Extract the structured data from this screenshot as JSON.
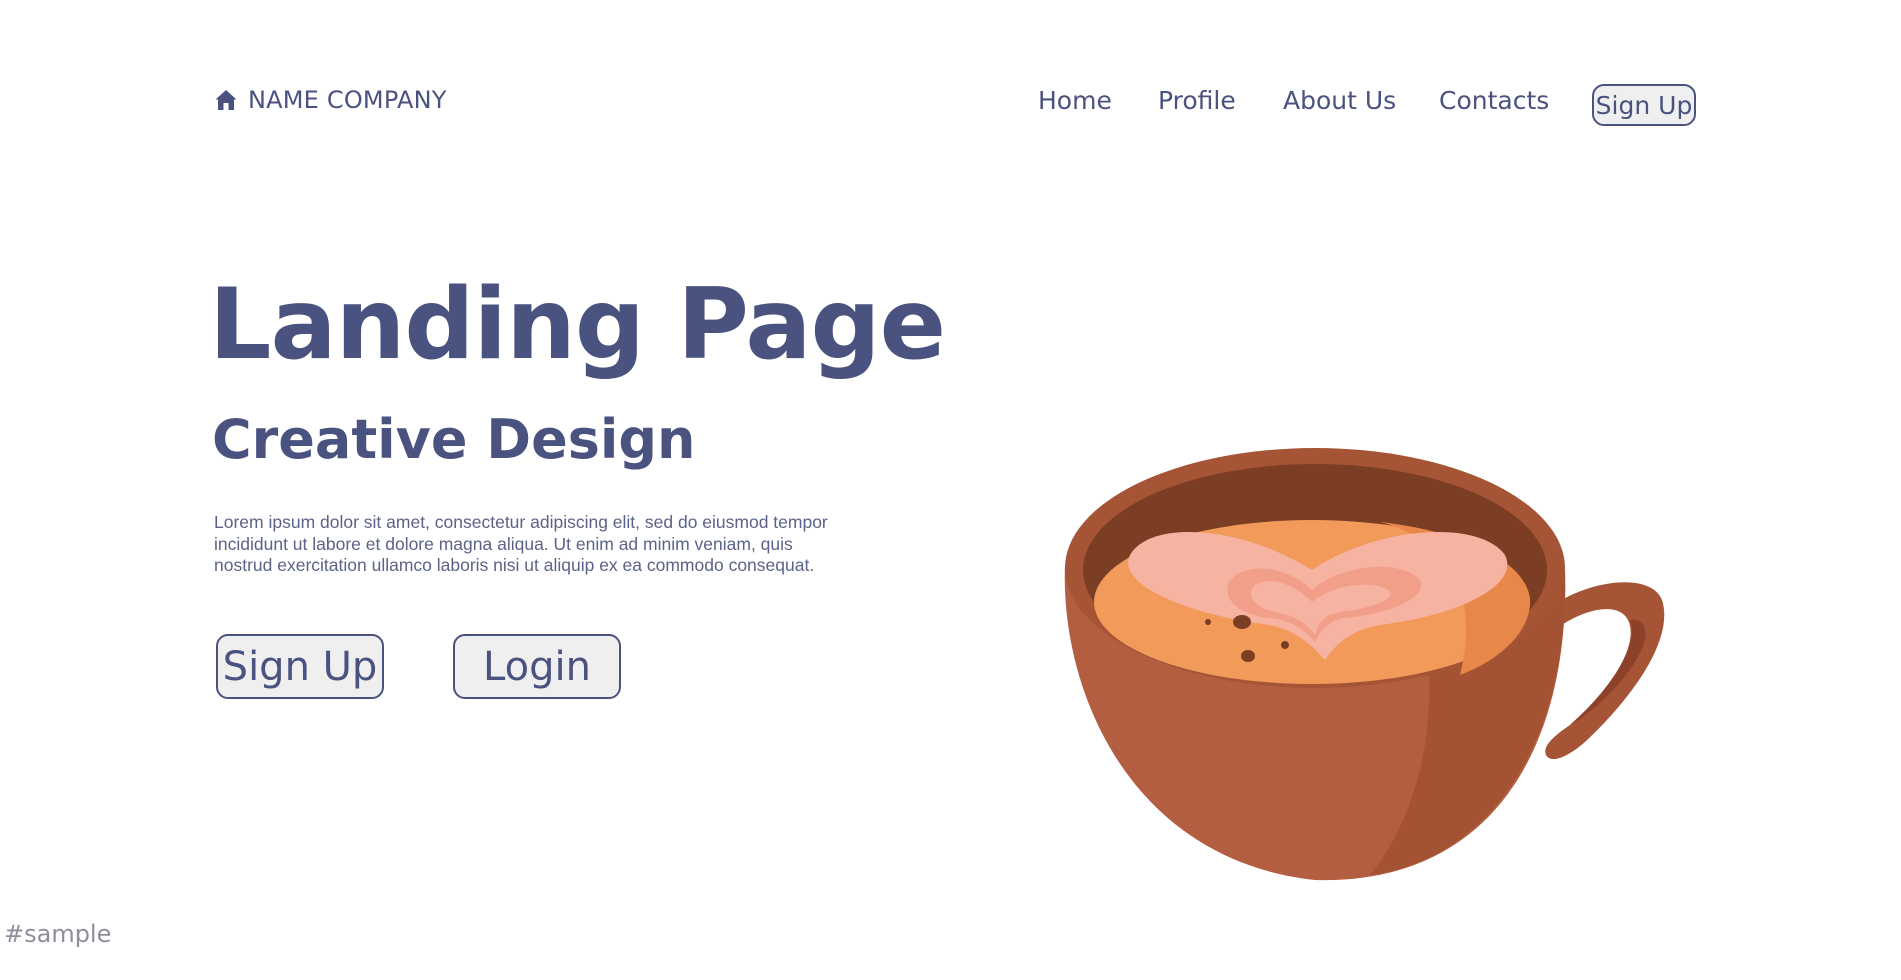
{
  "header": {
    "brand_icon": "home-icon",
    "brand_name": "NAME COMPANY",
    "nav": {
      "home": "Home",
      "profile": "Profile",
      "about": "About Us",
      "contacts": "Contacts",
      "signup": "Sign Up"
    }
  },
  "hero": {
    "title": "Landing Page",
    "subtitle": "Creative Design",
    "body": "Lorem ipsum dolor sit amet, consectetur adipiscing elit, sed do eiusmod tempor incididunt ut labore et dolore magna aliqua. Ut enim ad minim veniam, quis nostrud exercitation ullamco laboris nisi ut aliquip ex ea commodo consequat.",
    "signup_label": "Sign Up",
    "login_label": "Login"
  },
  "illustration": {
    "icon": "coffee-cup-icon"
  },
  "watermark": "#sample",
  "colors": {
    "text": "#4a5280",
    "button_bg": "#efefef",
    "cup": "#b35e40",
    "coffee": "#f19a5a",
    "foam": "#f7b3a1"
  }
}
